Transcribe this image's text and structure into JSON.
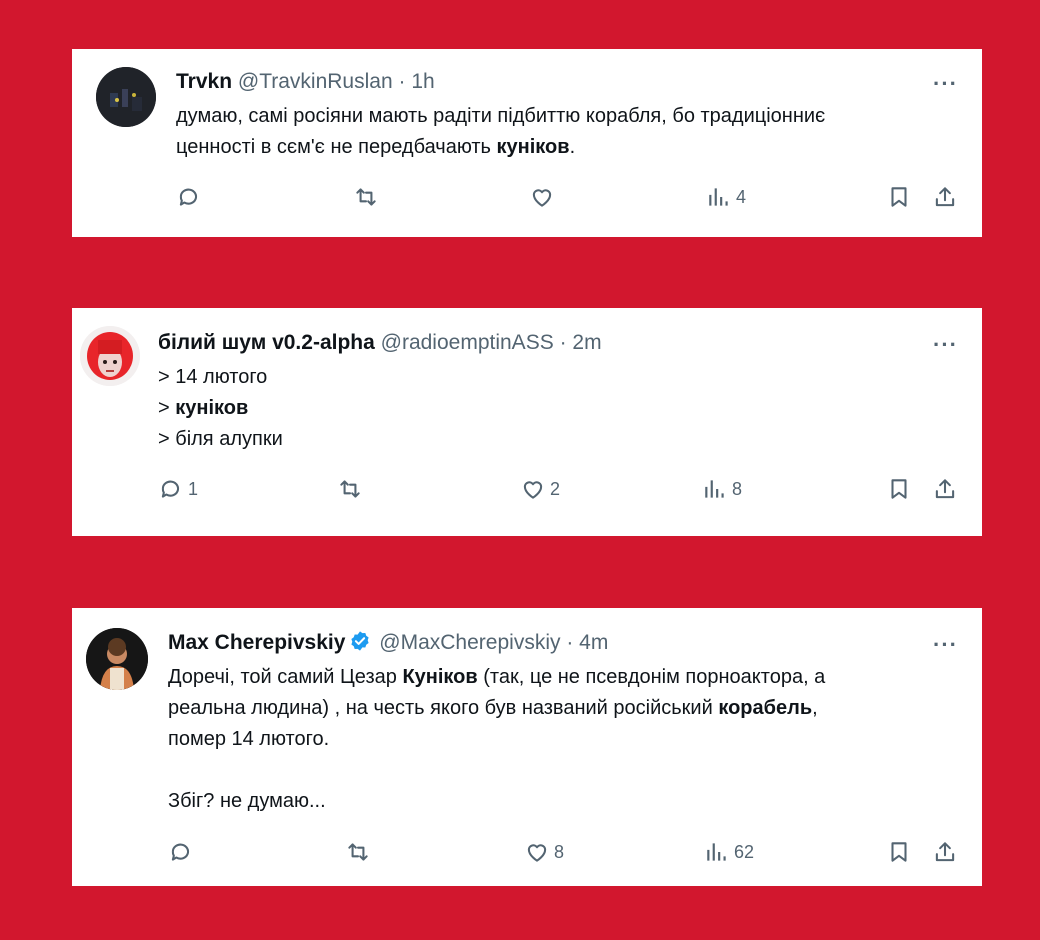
{
  "tweets": [
    {
      "name": "Trvkn",
      "handle": "@TravkinRuslan",
      "time": "1h",
      "lines": [
        [
          {
            "t": "думаю, самі росіяни мають радіти підбиттю корабля, бо традиціонниє",
            "b": false
          }
        ],
        [
          {
            "t": "ценності в сєм'є не передбачають ",
            "b": false
          },
          {
            "t": "куніков",
            "b": true
          },
          {
            "t": ".",
            "b": false
          }
        ]
      ],
      "reply_count": "",
      "retweet_count": "",
      "like_count": "",
      "view_count": "4"
    },
    {
      "name": "білий шум v0.2-alpha",
      "handle": "@radioemptinASS",
      "time": "2m",
      "lines": [
        [
          {
            "t": "> 14 лютого",
            "b": false
          }
        ],
        [
          {
            "t": "> ",
            "b": false
          },
          {
            "t": "куніков",
            "b": true
          }
        ],
        [
          {
            "t": "> біля алупки",
            "b": false
          }
        ]
      ],
      "reply_count": "1",
      "retweet_count": "",
      "like_count": "2",
      "view_count": "8"
    },
    {
      "name": "Max Cherepivskiy",
      "handle": "@MaxCherepivskiy",
      "time": "4m",
      "verified": true,
      "lines": [
        [
          {
            "t": "Доречі, той самий Цезар ",
            "b": false
          },
          {
            "t": "Куніков",
            "b": true
          },
          {
            "t": " (так, це не псевдонім порноактора, а",
            "b": false
          }
        ],
        [
          {
            "t": "реальна людина) , на честь якого був названий російський ",
            "b": false
          },
          {
            "t": "корабель",
            "b": true
          },
          {
            "t": ",",
            "b": false
          }
        ],
        [
          {
            "t": "помер 14 лютого.",
            "b": false
          }
        ],
        [
          {
            "t": "",
            "b": false
          }
        ],
        [
          {
            "t": "Збіг? не думаю...",
            "b": false
          }
        ]
      ],
      "reply_count": "",
      "retweet_count": "",
      "like_count": "8",
      "view_count": "62"
    }
  ],
  "separator": "·",
  "more_label": "···",
  "icons": {
    "reply": "reply-icon",
    "retweet": "retweet-icon",
    "like": "like-icon",
    "views": "views-icon",
    "bookmark": "bookmark-icon",
    "share": "share-icon",
    "verified": "verified-badge-icon"
  },
  "colors": {
    "background": "#d2172e",
    "card": "#ffffff",
    "text": "#0f1419",
    "muted": "#536471",
    "verified": "#1d9bf0"
  }
}
